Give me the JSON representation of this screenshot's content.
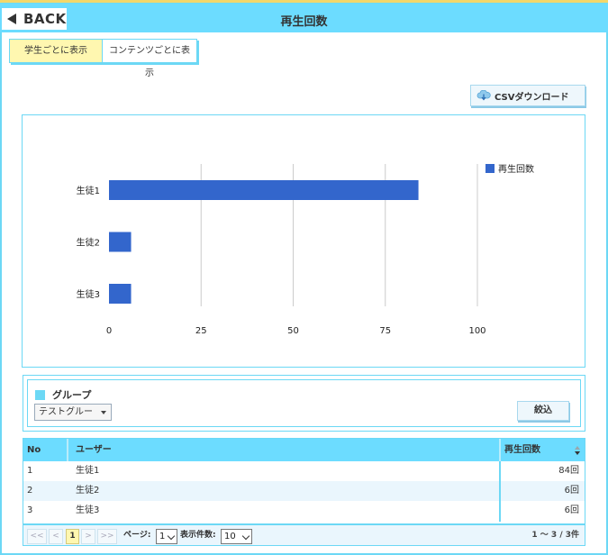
{
  "header": {
    "back_label": "BACK",
    "title": "再生回数"
  },
  "tabs": [
    {
      "label": "学生ごとに表示",
      "active": true
    },
    {
      "label": "コンテンツごとに表示",
      "active": false
    }
  ],
  "toolbar": {
    "csv_label": "CSVダウンロード"
  },
  "chart_data": {
    "type": "bar",
    "orientation": "horizontal",
    "categories": [
      "生徒1",
      "生徒2",
      "生徒3"
    ],
    "series": [
      {
        "name": "再生回数",
        "values": [
          84,
          6,
          6
        ],
        "color": "#3366cc"
      }
    ],
    "xlim": [
      0,
      100
    ],
    "xticks": [
      0,
      25,
      50,
      75,
      100
    ],
    "grid": true,
    "legend": "right"
  },
  "filter": {
    "group_label": "グループ",
    "group_selected": "テストグルー",
    "submit_label": "絞込"
  },
  "table": {
    "columns": [
      "No",
      "ユーザー",
      "再生回数"
    ],
    "rows": [
      {
        "no": "1",
        "user": "生徒1",
        "count": "84回"
      },
      {
        "no": "2",
        "user": "生徒2",
        "count": "6回"
      },
      {
        "no": "3",
        "user": "生徒3",
        "count": "6回"
      }
    ]
  },
  "pager": {
    "first": "<<",
    "prev": "<",
    "current": "1",
    "next": ">",
    "last": ">>",
    "page_label": "ページ:",
    "page_value": "1",
    "per_page_label": "表示件数:",
    "per_page_value": "10",
    "summary": "1 〜 3 / 3件"
  },
  "colors": {
    "accent": "#6cdcff",
    "bar": "#3366cc",
    "active_tab": "#fff7b0"
  }
}
